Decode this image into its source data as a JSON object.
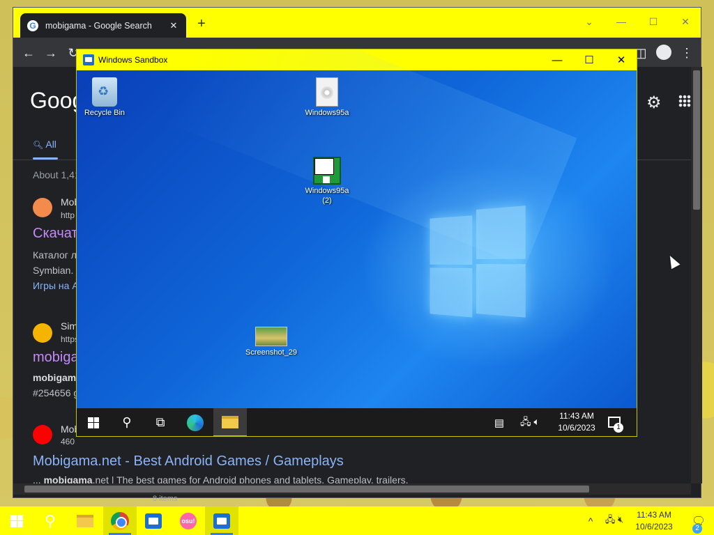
{
  "chrome": {
    "tab_title": "mobigama - Google Search",
    "tab_close": "✕",
    "new_tab": "+",
    "google_logo": "Goog",
    "tab_all": "All",
    "about": "About 1,41",
    "results": [
      {
        "site": "Mob",
        "url": "http",
        "title": "Скачат",
        "snippet1": "Каталог л",
        "snippet2": "Symbian.",
        "link": "Игры на A"
      },
      {
        "site": "Sim",
        "url": "https",
        "title": "mobiga",
        "snippet1": "mobigam",
        "snippet2": "#254656 g"
      },
      {
        "site": "Mob",
        "url": "460",
        "title": "Mobigama.net - Best Android Games / Gameplays",
        "snippet_pre": "... ",
        "snippet_bold": "mobigama",
        "snippet_rest": ".net | The best games for Android phones and tablets. Gameplay, trailers,"
      }
    ],
    "status_strip": "8 items"
  },
  "sandbox": {
    "title": "Windows Sandbox",
    "desktop_icons": [
      {
        "label": "Recycle Bin",
        "icon": "recycle-bin-icon"
      },
      {
        "label": "Windows95a",
        "icon": "disc-image-file-icon"
      },
      {
        "label": "Windows95a",
        "label2": "(2)",
        "icon": "setup-program-icon"
      },
      {
        "label": "Screenshot_29",
        "icon": "image-file-icon"
      }
    ],
    "clock_time": "11:43 AM",
    "clock_date": "10/6/2023",
    "notification_count": "1"
  },
  "host_taskbar": {
    "clock_time": "11:43 AM",
    "clock_date": "10/6/2023",
    "notification_count": "2",
    "osu_label": "osu!"
  },
  "colors": {
    "titlebar_accent": "#ffff00",
    "chrome_dark": "#202124",
    "link_blue": "#8ab4f8",
    "visited_purple": "#c58af9"
  }
}
